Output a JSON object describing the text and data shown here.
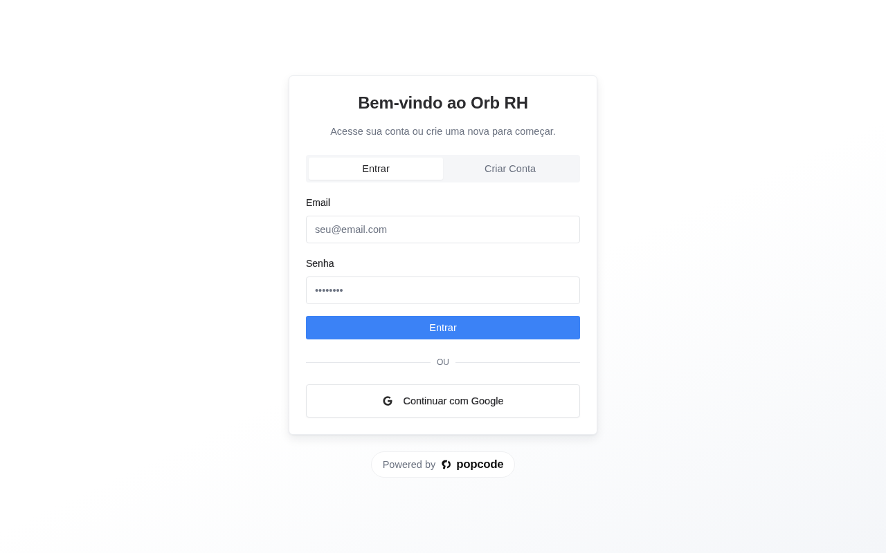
{
  "card": {
    "title": "Bem-vindo ao Orb RH",
    "subtitle": "Acesse sua conta ou crie uma nova para começar.",
    "tabs": [
      {
        "label": "Entrar",
        "selected": true
      },
      {
        "label": "Criar Conta",
        "selected": false
      }
    ],
    "fields": [
      {
        "label": "Email",
        "placeholder": "seu@email.com"
      },
      {
        "label": "Senha",
        "placeholder": "••••••••"
      }
    ],
    "submit_button": {
      "label": "Entrar"
    },
    "divider": {
      "label": "OU"
    },
    "google_button": {
      "label": "Continuar com Google"
    }
  },
  "footer": {
    "prefix": "Powered by",
    "brand": "popcode"
  }
}
